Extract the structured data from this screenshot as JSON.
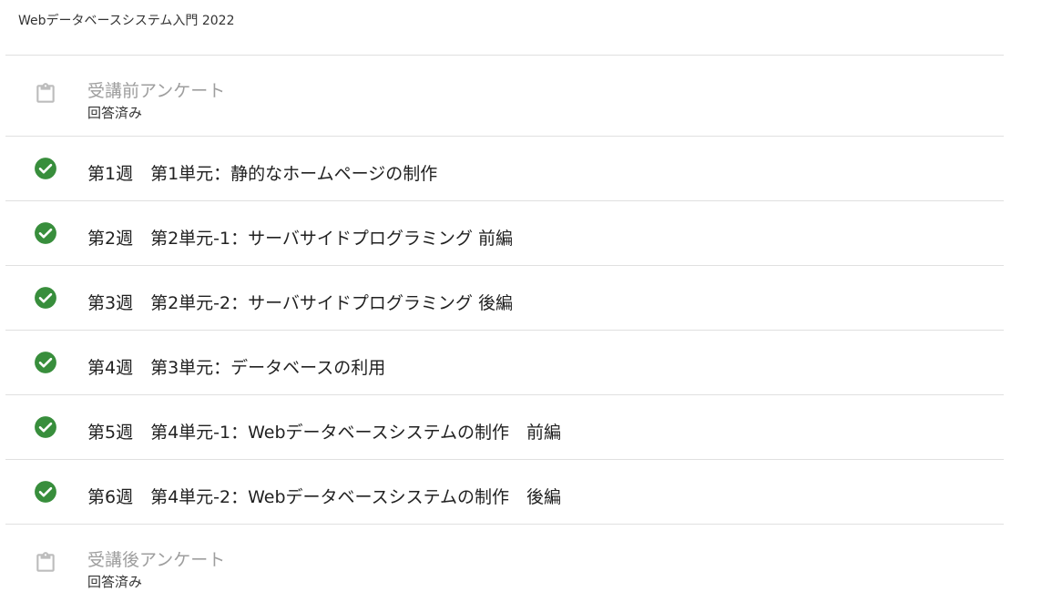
{
  "course": {
    "title": "Webデータベースシステム入門 2022"
  },
  "colors": {
    "check_green": "#388e3c",
    "survey_gray": "#9e9e9e",
    "divider": "#e0e0e0"
  },
  "items": [
    {
      "type": "survey",
      "icon": "clipboard-icon",
      "title": "受講前アンケート",
      "status": "回答済み"
    },
    {
      "type": "week",
      "icon": "check-circle-icon",
      "title": "第1週　第1単元：静的なホームページの制作"
    },
    {
      "type": "week",
      "icon": "check-circle-icon",
      "title": "第2週　第2単元-1：サーバサイドプログラミング 前編"
    },
    {
      "type": "week",
      "icon": "check-circle-icon",
      "title": "第3週　第2単元-2：サーバサイドプログラミング 後編"
    },
    {
      "type": "week",
      "icon": "check-circle-icon",
      "title": "第4週　第3単元：データベースの利用"
    },
    {
      "type": "week",
      "icon": "check-circle-icon",
      "title": "第5週　第4単元-1：Webデータベースシステムの制作　前編"
    },
    {
      "type": "week",
      "icon": "check-circle-icon",
      "title": "第6週　第4単元-2：Webデータベースシステムの制作　後編"
    },
    {
      "type": "survey",
      "icon": "clipboard-icon",
      "title": "受講後アンケート",
      "status": "回答済み"
    }
  ]
}
